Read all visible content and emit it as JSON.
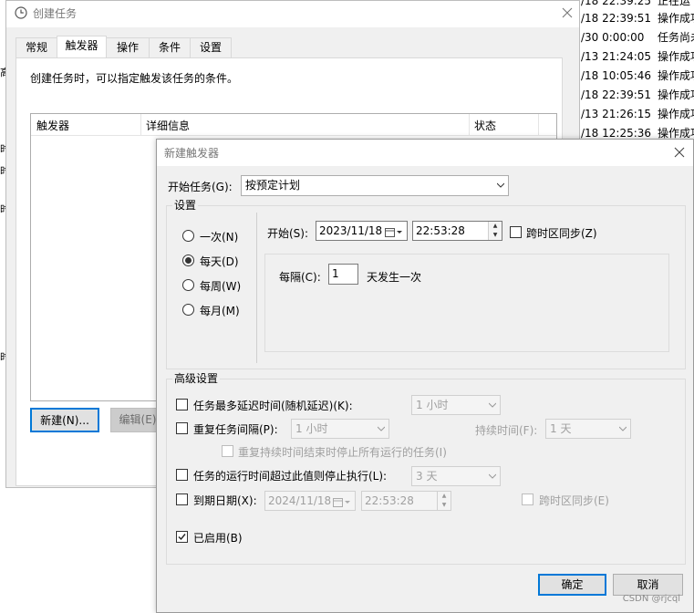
{
  "background_list": {
    "rows": [
      {
        "time": "/18 22:39:25",
        "status": "正在运"
      },
      {
        "time": "/18 22:39:51",
        "status": "操作成功"
      },
      {
        "time": "/30 0:00:00",
        "status": "任务尚未"
      },
      {
        "time": "/13 21:24:05",
        "status": "操作成功"
      },
      {
        "time": "/18 10:05:46",
        "status": "操作成功"
      },
      {
        "time": "/18 22:39:51",
        "status": "操作成功"
      },
      {
        "time": "/13 21:26:15",
        "status": "操作成功"
      },
      {
        "time": "/18 12:25:36",
        "status": "操作成功"
      }
    ],
    "left_fragments": [
      "高",
      "时",
      "时",
      "时",
      "时"
    ]
  },
  "create_task_window": {
    "title": "创建任务",
    "tabs": [
      {
        "label": "常规",
        "active": false
      },
      {
        "label": "触发器",
        "active": true
      },
      {
        "label": "操作",
        "active": false
      },
      {
        "label": "条件",
        "active": false
      },
      {
        "label": "设置",
        "active": false
      }
    ],
    "description": "创建任务时，可以指定触发该任务的条件。",
    "list_headers": [
      "触发器",
      "详细信息",
      "状态"
    ],
    "buttons": {
      "new": "新建(N)...",
      "edit": "编辑(E)"
    }
  },
  "new_trigger_dialog": {
    "title": "新建触发器",
    "begin_task_label": "开始任务(G):",
    "begin_task_value": "按预定计划",
    "settings_group": "设置",
    "schedule_options": [
      {
        "label": "一次(N)",
        "selected": false
      },
      {
        "label": "每天(D)",
        "selected": true
      },
      {
        "label": "每周(W)",
        "selected": false
      },
      {
        "label": "每月(M)",
        "selected": false
      }
    ],
    "start_label": "开始(S):",
    "start_date": "2023/11/18",
    "start_time": "22:53:28",
    "sync_timezone": "跨时区同步(Z)",
    "recur_label": "每隔(C):",
    "recur_value": "1",
    "recur_suffix": "天发生一次",
    "advanced_group": "高级设置",
    "delay_label": "任务最多延迟时间(随机延迟)(K):",
    "delay_value": "1 小时",
    "repeat_label": "重复任务间隔(P):",
    "repeat_value": "1 小时",
    "duration_label": "持续时间(F):",
    "duration_value": "1 天",
    "stop_all_label": "重复持续时间结束时停止所有运行的任务(I)",
    "stop_if_label": "任务的运行时间超过此值则停止执行(L):",
    "stop_if_value": "3 天",
    "expire_label": "到期日期(X):",
    "expire_date": "2024/11/18",
    "expire_time": "22:53:28",
    "expire_sync": "跨时区同步(E)",
    "enabled_label": "已启用(B)",
    "enabled": true,
    "ok": "确定",
    "cancel": "取消"
  },
  "watermark": "CSDN @rjcql"
}
